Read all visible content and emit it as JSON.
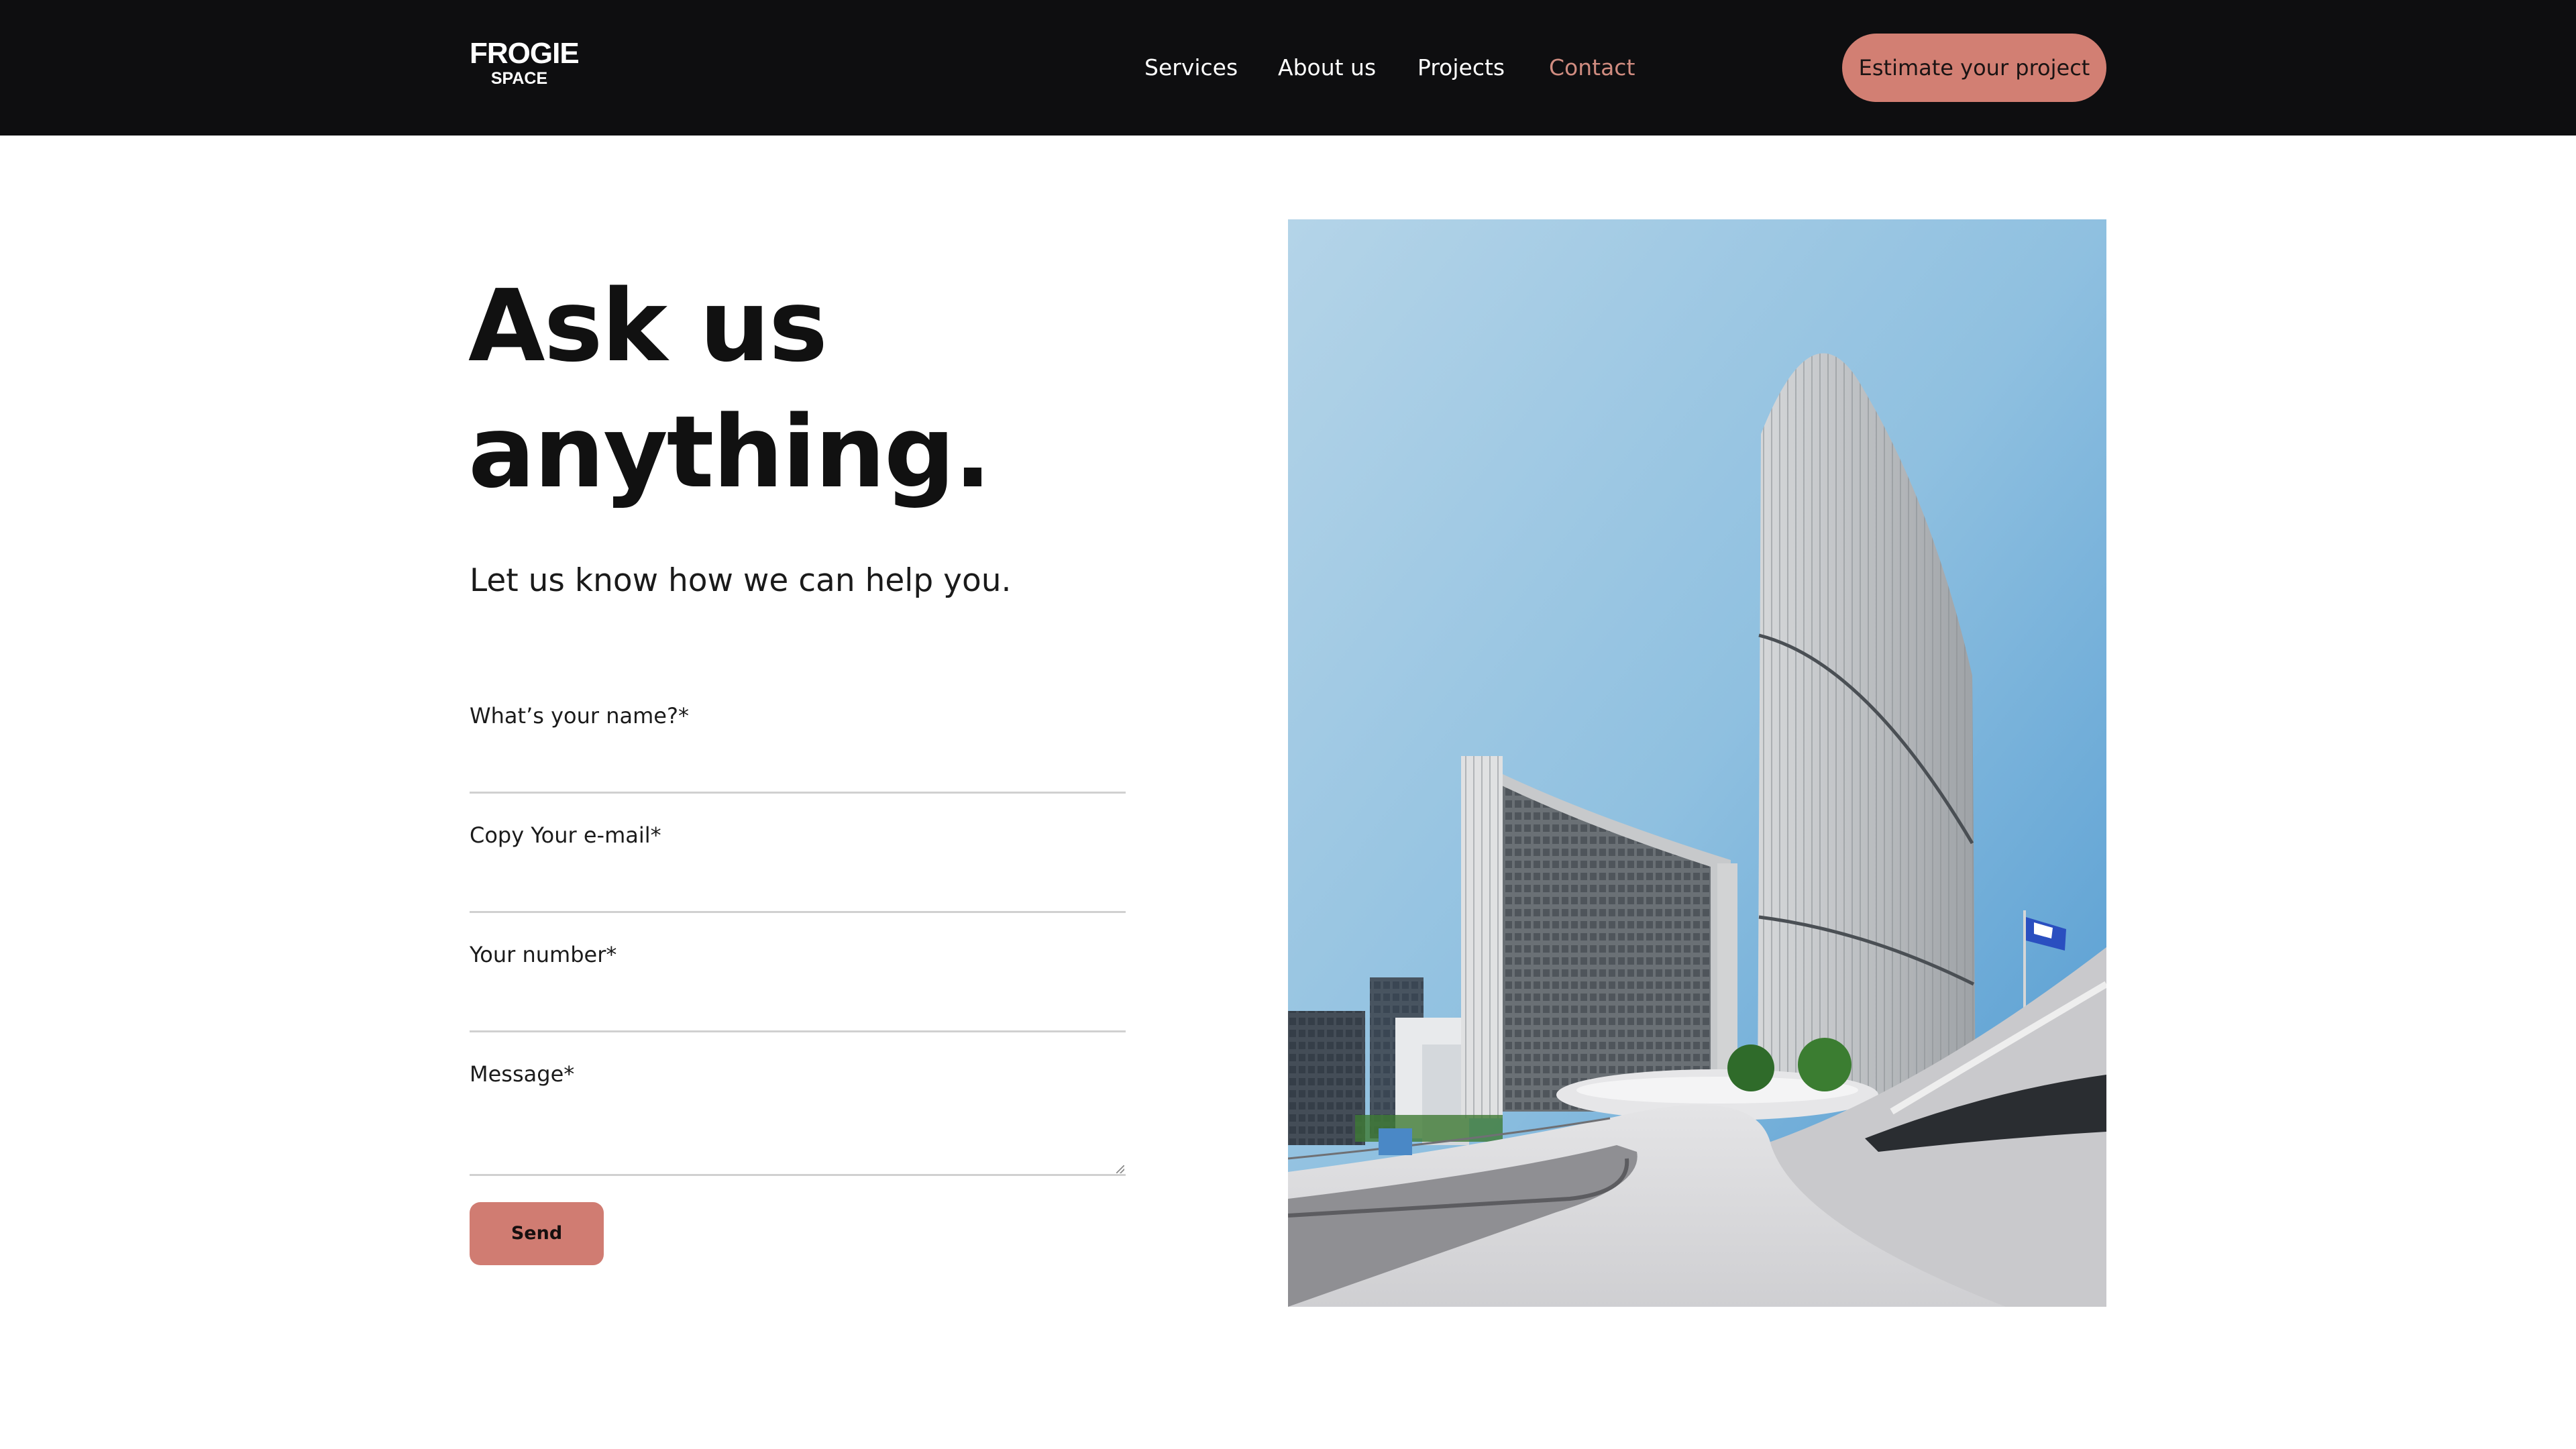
{
  "brand": {
    "logo_line1": "FROGIE",
    "logo_line2": "SPACE"
  },
  "nav": {
    "items": [
      {
        "label": "Services"
      },
      {
        "label": "About us"
      },
      {
        "label": "Projects"
      },
      {
        "label": "Contact",
        "active": true
      }
    ],
    "cta_label": "Estimate your project"
  },
  "hero": {
    "headline_line1": "Ask us",
    "headline_line2": "anything.",
    "subhead": "Let us know how we can help you."
  },
  "form": {
    "fields": [
      {
        "label": "What’s your name?*",
        "value": ""
      },
      {
        "label": "Copy Your e-mail*",
        "value": ""
      },
      {
        "label": "Your number*",
        "value": ""
      },
      {
        "label": "Message*",
        "value": ""
      }
    ],
    "submit_label": "Send"
  },
  "image": {
    "alt_subject": "city-hall-towers-photo"
  },
  "colors": {
    "header_bg": "#0e0e10",
    "accent": "#d27f73",
    "nav_active": "#d08c80",
    "text": "#111111"
  }
}
